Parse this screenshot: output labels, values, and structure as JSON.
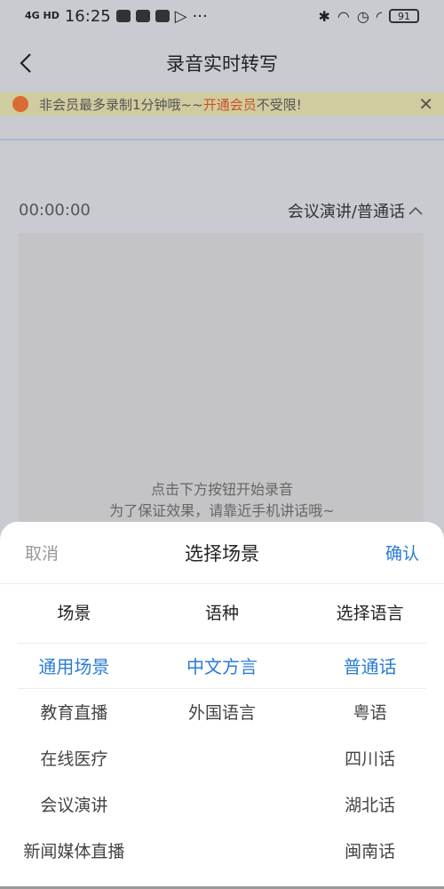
{
  "status_bar": {
    "network": "4G HD",
    "time": "16:25",
    "battery": "91"
  },
  "header": {
    "title": "录音实时转写"
  },
  "banner": {
    "text_prefix": "非会员最多录制1分钟哦~~",
    "link": "开通会员",
    "text_suffix": " 不受限!",
    "close": "✕"
  },
  "recorder": {
    "time": "00:00:00",
    "scene": "会议演讲/普通话",
    "hint1": "点击下方按钮开始录音",
    "hint2": "为了保证效果，请靠近手机讲话哦~"
  },
  "sheet": {
    "cancel": "取消",
    "title": "选择场景",
    "confirm": "确认",
    "headers": [
      "场景",
      "语种",
      "选择语言"
    ],
    "col1": [
      "通用场景",
      "教育直播",
      "在线医疗",
      "会议演讲",
      "新闻媒体直播"
    ],
    "col2": [
      "中文方言",
      "外国语言"
    ],
    "col3": [
      "普通话",
      "粤语",
      "四川话",
      "湖北话",
      "闽南话"
    ]
  },
  "colors": {
    "accent": "#2a7bd3",
    "banner_link": "#c9522a"
  }
}
